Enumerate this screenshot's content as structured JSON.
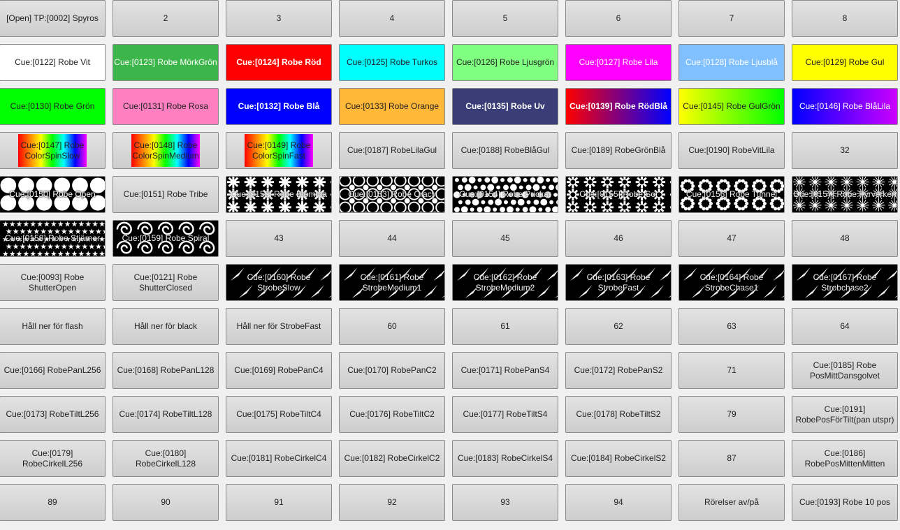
{
  "buttons": [
    [
      "[Open] TP:[0002] Spyros",
      "2",
      "3",
      "4",
      "5",
      "6",
      "7",
      "8"
    ],
    [
      "Cue:[0122] Robe Vit",
      "Cue:[0123] Robe MörkGrön",
      "Cue:[0124] Robe Röd",
      "Cue:[0125] Robe Turkos",
      "Cue:[0126] Robe Ljusgrön",
      "Cue:[0127] Robe Lila",
      "Cue:[0128] Robe Ljusblå",
      "Cue:[0129] Robe Gul"
    ],
    [
      "Cue:[0130] Robe Grön",
      "Cue:[0131] Robe Rosa",
      "Cue:[0132] Robe Blå",
      "Cue:[0133] Robe Orange",
      "Cue:[0135] Robe Uv",
      "Cue:[0139] Robe RödBlå",
      "Cue:[0145] Robe GulGrön",
      "Cue:[0146] Robe BlåLila"
    ],
    [
      "Cue:[0147] Robe\nColorSpinSlow",
      "Cue:[0148] Robe\nColorSpinMedium",
      "Cue:[0149] Robe\nColorSpinFast",
      "Cue:[0187] RobeLilaGul",
      "Cue:[0188] RobeBlåGul",
      "Cue:[0189] RobeGrönBlå",
      "Cue:[0190] RobeVitLila",
      "32"
    ],
    [
      "Cue:[0150] Robe Open",
      "Cue:[0151] Robe Tribe",
      "Cue:[0152] Robe Blomma",
      "Cue:[0153] Robe Cracy",
      "Cue:[0154] Robe Prickar",
      "Cue:[0155] Robe Sol",
      "Cue:[0156] Robe Tunnel",
      "Cue:[0157] Robe Fyrverkeri"
    ],
    [
      "Cue:[0158] Robe Stjärnor",
      "Cue:[0159] Robe Spiral",
      "43",
      "44",
      "45",
      "46",
      "47",
      "48"
    ],
    [
      "Cue:[0093] Robe\nShutterOpen",
      "Cue:[0121] Robe\nShutterClosed",
      "Cue:[0160] Robe\nStrobeSlow",
      "Cue:[0161] Robe\nStrobeMedium1",
      "Cue:[0162] Robe\nStrobeMedium2",
      "Cue:[0163] Robe\nStrobeFast",
      "Cue:[0164] Robe\nStrobeChase1",
      "Cue:[0167] Robe\nStrobchase2"
    ],
    [
      "Håll ner för flash",
      "Håll ner för black",
      "Håll ner för StrobeFast",
      "60",
      "61",
      "62",
      "63",
      "64"
    ],
    [
      "Cue:[0166] RobePanL256",
      "Cue:[0168] RobePanL128",
      "Cue:[0169] RobePanC4",
      "Cue:[0170] RobePanC2",
      "Cue:[0171] RobePanS4",
      "Cue:[0172] RobePanS2",
      "71",
      "Cue:[0185] Robe\nPosMittDansgolvet"
    ],
    [
      "Cue:[0173] RobeTiltL256",
      "Cue:[0174] RobeTiltL128",
      "Cue:[0175] RobeTiltC4",
      "Cue:[0176] RobeTiltC2",
      "Cue:[0177] RobeTiltS4",
      "Cue:[0178] RobeTiltS2",
      "79",
      "Cue:[0191]\nRobePosFörTilt(pan utspr)"
    ],
    [
      "Cue:[0179] RobeCirkelL256",
      "Cue:[0180] RobeCirkelL128",
      "Cue:[0181] RobeCirkelC4",
      "Cue:[0182] RobeCirkelC2",
      "Cue:[0183] RobeCirkelS4",
      "Cue:[0184] RobeCirkelS2",
      "87",
      "Cue:[0186]\nRobePosMittenMitten"
    ],
    [
      "89",
      "90",
      "91",
      "92",
      "93",
      "94",
      "Rörelser av/på",
      "Cue:[0193] Robe 10 pos"
    ]
  ],
  "styles": [
    [
      "",
      "",
      "",
      "",
      "",
      "",
      "",
      ""
    ],
    [
      "c-white",
      "c-green",
      "c-red",
      "c-cyan",
      "c-lgreen",
      "c-mag",
      "c-lblue",
      "c-yellow"
    ],
    [
      "c-bgreen",
      "c-pink",
      "c-blue",
      "c-orange",
      "c-uv",
      "c-redblue",
      "c-yellowgreen",
      "c-bluelila"
    ],
    [
      "rainbow",
      "rainbow",
      "rainbow",
      "",
      "",
      "",
      "",
      ""
    ],
    [
      "pattern pat-open",
      "",
      "pattern pat-flower",
      "pattern pat-cracy",
      "pattern pat-dots",
      "pattern pat-sun",
      "pattern pat-tunnel",
      "pattern pat-firework"
    ],
    [
      "pattern pat-stars",
      "pattern pat-spiral",
      "",
      "",
      "",
      "",
      "",
      ""
    ],
    [
      "",
      "",
      "pattern pat-strobe",
      "pattern pat-strobe",
      "pattern pat-strobe",
      "pattern pat-strobe",
      "pattern pat-strobe",
      "pattern pat-strobe"
    ],
    [
      "",
      "",
      "",
      "",
      "",
      "",
      "",
      ""
    ],
    [
      "",
      "",
      "",
      "",
      "",
      "",
      "",
      ""
    ],
    [
      "",
      "",
      "",
      "",
      "",
      "",
      "",
      ""
    ],
    [
      "",
      "",
      "",
      "",
      "",
      "",
      "",
      ""
    ],
    [
      "",
      "",
      "",
      "",
      "",
      "",
      "",
      ""
    ]
  ]
}
